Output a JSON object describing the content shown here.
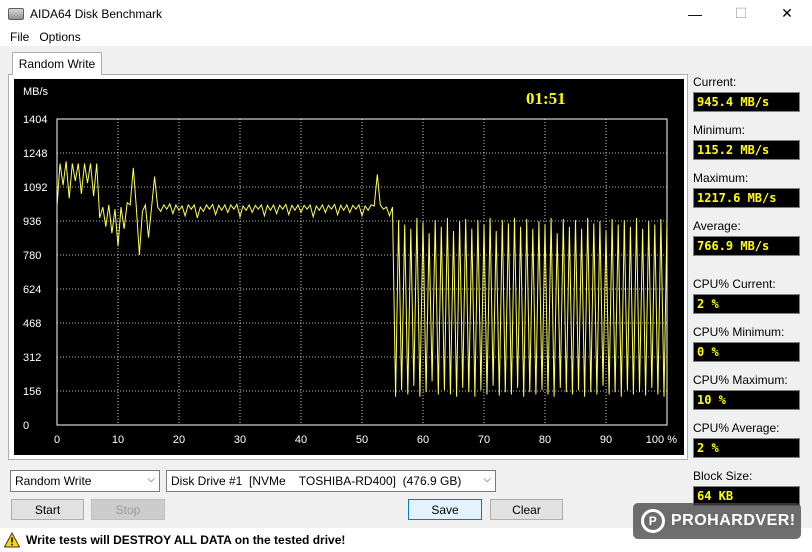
{
  "window": {
    "title": "AIDA64 Disk Benchmark",
    "minimize_icon": "minimize-icon",
    "maximize_icon": "maximize-icon",
    "close_icon": "close-icon"
  },
  "menu": {
    "items": [
      "File",
      "Options"
    ]
  },
  "tab": {
    "label": "Random Write"
  },
  "stats": {
    "current_label": "Current:",
    "current_value": "945.4 MB/s",
    "minimum_label": "Minimum:",
    "minimum_value": "115.2 MB/s",
    "maximum_label": "Maximum:",
    "maximum_value": "1217.6 MB/s",
    "average_label": "Average:",
    "average_value": "766.9 MB/s",
    "cpu_current_label": "CPU% Current:",
    "cpu_current_value": "2 %",
    "cpu_minimum_label": "CPU% Minimum:",
    "cpu_minimum_value": "0 %",
    "cpu_maximum_label": "CPU% Maximum:",
    "cpu_maximum_value": "10 %",
    "cpu_average_label": "CPU% Average:",
    "cpu_average_value": "2 %",
    "block_size_label": "Block Size:",
    "block_size_value": "64 KB"
  },
  "controls": {
    "test_select": "Random Write",
    "drive_select": "Disk Drive #1  [NVMe    TOSHIBA-RD400]  (476.9 GB)",
    "start_label": "Start",
    "stop_label": "Stop",
    "save_label": "Save",
    "clear_label": "Clear"
  },
  "warning": {
    "text": "Write tests will DESTROY ALL DATA on the tested drive!"
  },
  "watermark": {
    "text": "PROHARDVER!"
  },
  "chart_data": {
    "type": "line",
    "ylabel": "MB/s",
    "elapsed": "01:51",
    "ylim": [
      0,
      1404
    ],
    "xlim": [
      0,
      100
    ],
    "y_ticks": [
      0,
      156,
      312,
      468,
      624,
      780,
      936,
      1092,
      1248,
      1404
    ],
    "x_ticks": [
      "0",
      "10",
      "20",
      "30",
      "40",
      "50",
      "60",
      "70",
      "80",
      "90",
      "100 %"
    ],
    "grid": true,
    "colors": {
      "background": "#000000",
      "grid": "#ffffff",
      "line": "#ffff55",
      "text": "#ffffff",
      "timer": "#ffff00"
    },
    "series": [
      {
        "values": [
          [
            0,
            1000
          ],
          [
            0.5,
            1200
          ],
          [
            1,
            1100
          ],
          [
            1.5,
            1210
          ],
          [
            2,
            1040
          ],
          [
            2.5,
            1200
          ],
          [
            3,
            1120
          ],
          [
            3.5,
            1200
          ],
          [
            4,
            1060
          ],
          [
            4.5,
            1200
          ],
          [
            5,
            1110
          ],
          [
            5.5,
            1200
          ],
          [
            6,
            1050
          ],
          [
            6.5,
            1200
          ],
          [
            7,
            950
          ],
          [
            7.5,
            1000
          ],
          [
            8,
            910
          ],
          [
            8.5,
            1010
          ],
          [
            9,
            880
          ],
          [
            9.5,
            990
          ],
          [
            10,
            820
          ],
          [
            10.5,
            1000
          ],
          [
            11,
            900
          ],
          [
            11.5,
            1020
          ],
          [
            12,
            1010
          ],
          [
            12.5,
            1180
          ],
          [
            13,
            1000
          ],
          [
            13.5,
            780
          ],
          [
            14,
            980
          ],
          [
            14.5,
            1010
          ],
          [
            15,
            860
          ],
          [
            15.5,
            1000
          ],
          [
            16,
            1140
          ],
          [
            16.5,
            1000
          ],
          [
            17,
            980
          ],
          [
            17.5,
            1010
          ],
          [
            18,
            990
          ],
          [
            18.5,
            1015
          ],
          [
            19,
            970
          ],
          [
            19.5,
            1010
          ],
          [
            20,
            985
          ],
          [
            20.5,
            1005
          ],
          [
            21,
            960
          ],
          [
            21.5,
            1010
          ],
          [
            22,
            990
          ],
          [
            22.5,
            1010
          ],
          [
            23,
            950
          ],
          [
            23.5,
            1000
          ],
          [
            24,
            980
          ],
          [
            24.5,
            1010
          ],
          [
            25,
            990
          ],
          [
            25.5,
            1012
          ],
          [
            26,
            965
          ],
          [
            26.5,
            1008
          ],
          [
            27,
            985
          ],
          [
            27.5,
            1010
          ],
          [
            28,
            975
          ],
          [
            28.5,
            1010
          ],
          [
            29,
            990
          ],
          [
            29.5,
            1012
          ],
          [
            30,
            955
          ],
          [
            30.5,
            1005
          ],
          [
            31,
            985
          ],
          [
            31.5,
            1010
          ],
          [
            32,
            975
          ],
          [
            32.5,
            1008
          ],
          [
            33,
            990
          ],
          [
            33.5,
            1010
          ],
          [
            34,
            960
          ],
          [
            34.5,
            1008
          ],
          [
            35,
            985
          ],
          [
            35.5,
            1010
          ],
          [
            36,
            970
          ],
          [
            36.5,
            1008
          ],
          [
            37,
            990
          ],
          [
            37.5,
            1012
          ],
          [
            38,
            965
          ],
          [
            38.5,
            1008
          ],
          [
            39,
            985
          ],
          [
            39.5,
            1010
          ],
          [
            40,
            975
          ],
          [
            40.5,
            1008
          ],
          [
            41,
            990
          ],
          [
            41.5,
            1010
          ],
          [
            42,
            955
          ],
          [
            42.5,
            1005
          ],
          [
            43,
            985
          ],
          [
            43.5,
            1010
          ],
          [
            44,
            975
          ],
          [
            44.5,
            1008
          ],
          [
            45,
            990
          ],
          [
            45.5,
            1012
          ],
          [
            46,
            965
          ],
          [
            46.5,
            1008
          ],
          [
            47,
            985
          ],
          [
            47.5,
            1010
          ],
          [
            48,
            975
          ],
          [
            48.5,
            1008
          ],
          [
            49,
            990
          ],
          [
            49.5,
            1010
          ],
          [
            50,
            960
          ],
          [
            50.5,
            1005
          ],
          [
            51,
            985
          ],
          [
            51.5,
            1010
          ],
          [
            52,
            1005
          ],
          [
            52.5,
            1150
          ],
          [
            53,
            1010
          ],
          [
            53.5,
            990
          ],
          [
            54,
            1000
          ],
          [
            54.5,
            960
          ],
          [
            55,
            1000
          ],
          [
            55.5,
            130
          ],
          [
            56,
            940
          ],
          [
            56.5,
            160
          ],
          [
            57,
            920
          ],
          [
            57.5,
            140
          ],
          [
            58,
            900
          ],
          [
            58.5,
            180
          ],
          [
            59,
            950
          ],
          [
            59.5,
            130
          ],
          [
            60,
            930
          ],
          [
            60.5,
            150
          ],
          [
            61,
            880
          ],
          [
            61.5,
            200
          ],
          [
            62,
            940
          ],
          [
            62.5,
            140
          ],
          [
            63,
            910
          ],
          [
            63.5,
            160
          ],
          [
            64,
            950
          ],
          [
            64.5,
            140
          ],
          [
            65,
            890
          ],
          [
            65.5,
            130
          ],
          [
            66,
            935
          ],
          [
            66.5,
            170
          ],
          [
            67,
            945
          ],
          [
            67.5,
            150
          ],
          [
            68,
            900
          ],
          [
            68.5,
            130
          ],
          [
            69,
            940
          ],
          [
            69.5,
            160
          ],
          [
            70,
            920
          ],
          [
            70.5,
            140
          ],
          [
            71,
            950
          ],
          [
            71.5,
            180
          ],
          [
            72,
            890
          ],
          [
            72.5,
            135
          ],
          [
            73,
            940
          ],
          [
            73.5,
            150
          ],
          [
            74,
            925
          ],
          [
            74.5,
            140
          ],
          [
            75,
            950
          ],
          [
            75.5,
            170
          ],
          [
            76,
            910
          ],
          [
            76.5,
            130
          ],
          [
            77,
            945
          ],
          [
            77.5,
            150
          ],
          [
            78,
            900
          ],
          [
            78.5,
            140
          ],
          [
            79,
            935
          ],
          [
            79.5,
            160
          ],
          [
            80,
            920
          ],
          [
            80.5,
            140
          ],
          [
            81,
            950
          ],
          [
            81.5,
            130
          ],
          [
            82,
            880
          ],
          [
            82.5,
            170
          ],
          [
            83,
            945
          ],
          [
            83.5,
            150
          ],
          [
            84,
            910
          ],
          [
            84.5,
            140
          ],
          [
            85,
            940
          ],
          [
            85.5,
            160
          ],
          [
            86,
            900
          ],
          [
            86.5,
            130
          ],
          [
            87,
            950
          ],
          [
            87.5,
            150
          ],
          [
            88,
            925
          ],
          [
            88.5,
            140
          ],
          [
            89,
            935
          ],
          [
            89.5,
            180
          ],
          [
            90,
            890
          ],
          [
            90.5,
            140
          ],
          [
            91,
            945
          ],
          [
            91.5,
            150
          ],
          [
            92,
            920
          ],
          [
            92.5,
            130
          ],
          [
            93,
            940
          ],
          [
            93.5,
            160
          ],
          [
            94,
            910
          ],
          [
            94.5,
            140
          ],
          [
            95,
            950
          ],
          [
            95.5,
            150
          ],
          [
            96,
            900
          ],
          [
            96.5,
            135
          ],
          [
            97,
            935
          ],
          [
            97.5,
            170
          ],
          [
            98,
            920
          ],
          [
            98.5,
            140
          ],
          [
            99,
            945
          ],
          [
            99.5,
            130
          ],
          [
            100,
            945
          ]
        ]
      }
    ]
  }
}
